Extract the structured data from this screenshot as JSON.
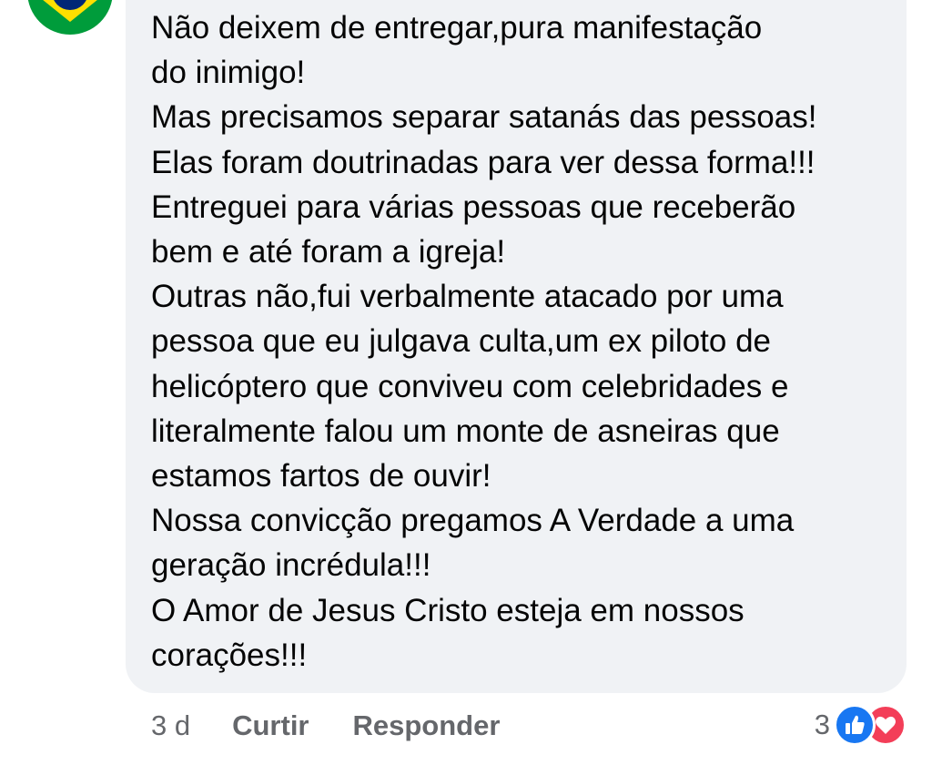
{
  "comment": {
    "lines": [
      "Não deixem de entregar,pura manifestação",
      "do inimigo!",
      "Mas precisamos separar satanás das pessoas!",
      "Elas foram doutrinadas para ver dessa forma!!!",
      "Entreguei para várias pessoas que receberão",
      "bem e até foram a igreja!",
      "Outras não,fui verbalmente atacado por uma",
      "pessoa que eu julgava culta,um ex piloto de",
      "helicóptero que conviveu com celebridades e",
      "literalmente falou um monte de asneiras que",
      "estamos fartos de ouvir!",
      "Nossa convicção pregamos A Verdade a uma",
      "geração incrédula!!!",
      "O Amor de Jesus Cristo esteja em nossos",
      "corações!!!"
    ]
  },
  "actions": {
    "timestamp": "3 d",
    "like_label": "Curtir",
    "reply_label": "Responder"
  },
  "reactions": {
    "count": "3",
    "types": [
      "like-icon",
      "love-icon"
    ],
    "like_color": "#1877f2",
    "love_color": "#f33e58"
  },
  "avatar": {
    "icon": "brazil-flag-icon",
    "colors": [
      "#009c3b",
      "#ffdf00",
      "#002776"
    ]
  },
  "colors": {
    "bubble": "#f0f2f5",
    "text": "#050505",
    "secondary_text": "#65676b"
  }
}
